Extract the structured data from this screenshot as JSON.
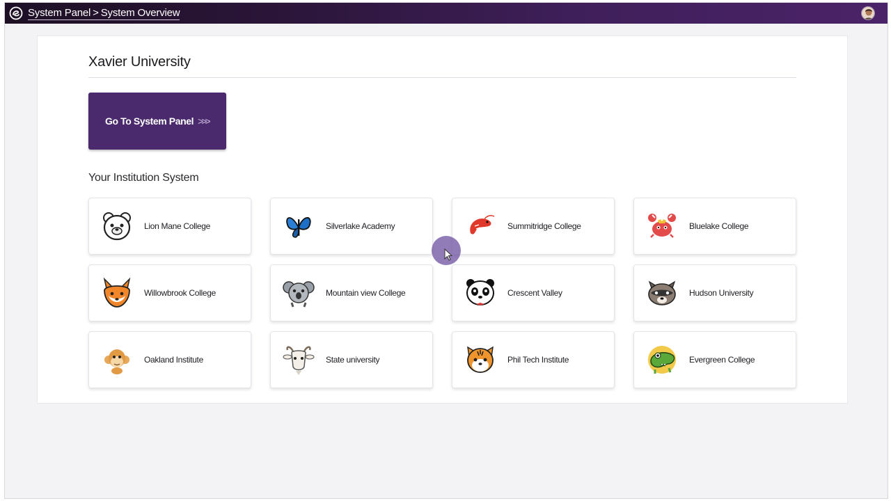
{
  "header": {
    "breadcrumb": {
      "root": "System Panel",
      "separator": ">",
      "current": "System Overview"
    },
    "logo_icon": "swirl-logo-icon",
    "avatar_icon": "user-avatar"
  },
  "main": {
    "title": "Xavier University",
    "go_button": {
      "label": "Go To System Panel",
      "chevrons": ">>>"
    },
    "section_title": "Your Institution System",
    "institutions": [
      {
        "name": "Lion Mane College",
        "icon": "bear-mascot-icon"
      },
      {
        "name": "Silverlake Academy",
        "icon": "butterfly-mascot-icon"
      },
      {
        "name": "Summitridge College",
        "icon": "shrimp-mascot-icon"
      },
      {
        "name": "Bluelake College",
        "icon": "crab-mascot-icon"
      },
      {
        "name": "Willowbrook College",
        "icon": "fox-mascot-icon"
      },
      {
        "name": "Mountain view College",
        "icon": "koala-mascot-icon"
      },
      {
        "name": "Crescent Valley",
        "icon": "panda-mascot-icon"
      },
      {
        "name": "Hudson University",
        "icon": "raccoon-mascot-icon"
      },
      {
        "name": "Oakland Institute",
        "icon": "monkey-mascot-icon"
      },
      {
        "name": "State university",
        "icon": "goat-mascot-icon"
      },
      {
        "name": "Phil Tech Institute",
        "icon": "tiger-mascot-icon"
      },
      {
        "name": "Evergreen College",
        "icon": "crocodile-mascot-icon"
      }
    ]
  },
  "colors": {
    "topbar_start": "#1d1024",
    "topbar_end": "#4b2368",
    "accent": "#4a2a6d",
    "cursor": "#6e50a0"
  }
}
